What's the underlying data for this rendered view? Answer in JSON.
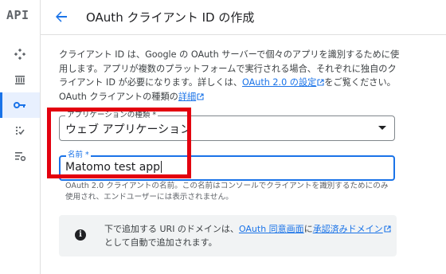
{
  "rail": {
    "logo": "API",
    "items": [
      {
        "icon": "diamond-grid-icon",
        "active": false
      },
      {
        "icon": "library-icon",
        "active": false
      },
      {
        "icon": "key-icon",
        "active": true
      },
      {
        "icon": "checklist-icon",
        "active": false
      },
      {
        "icon": "settings-list-icon",
        "active": false
      }
    ]
  },
  "header": {
    "title": "OAuth クライアント ID の作成"
  },
  "description": {
    "text": "クライアント ID は、Google の OAuth サーバーで個々のアプリを識別するために使用します。アプリが複数のプラットフォームで実行される場合、それぞれに独自のクライアント ID が必要になります。詳しくは、",
    "link1": "OAuth 2.0 の設定",
    "middle": "をご覧ください。 OAuth クライアントの種類の",
    "link2": "詳細"
  },
  "app_type": {
    "label": "アプリケーションの種類 *",
    "value": "ウェブ アプリケーション"
  },
  "name_field": {
    "label": "名前 *",
    "value": "Matomo test app",
    "helper": "OAuth 2.0 クライアントの名前。この名前はコンソールでクライアントを識別するためにのみ使用され、エンドユーザーには表示されません。"
  },
  "info": {
    "text1": "下で追加する URI のドメインは、",
    "link1": "OAuth 同意画面",
    "text2": "に",
    "link2": "承認済みドメイン",
    "text3": "として自動で追加されます。"
  },
  "colors": {
    "accent": "#1a73e8",
    "highlight": "#e3000f",
    "info_bg": "#f1f3f4"
  }
}
